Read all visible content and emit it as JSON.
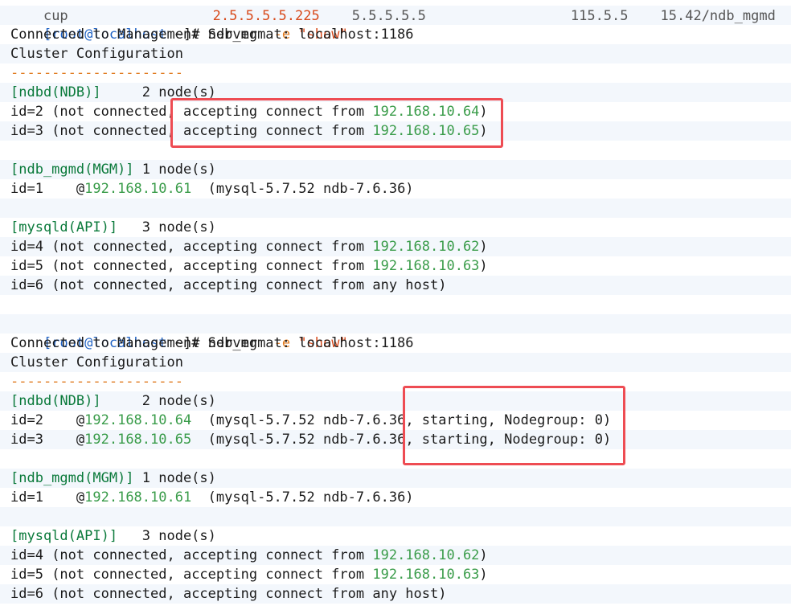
{
  "top_fragments": [
    {
      "text": "cup"
    },
    {
      "text": "2.5.5.5.5.225"
    },
    {
      "text": "5.5.5.5.5"
    },
    {
      "text": "115.5.5"
    },
    {
      "text": "15.42/ndb_mgmd"
    }
  ],
  "prompt": {
    "open": "[",
    "user_host": "root@localhost",
    "dir": " ~",
    "close": "]#",
    "cmd": " ndb_mgm ",
    "opt": "-e",
    "arg": "\"show\""
  },
  "texts": {
    "connected": "Connected to Management Server at: localhost:1186",
    "cluster_config": "Cluster Configuration",
    "separator": "---------------------",
    "ndbd_header_a": "[ndbd(NDB)]",
    "ndbd_header_b": "     2 node(s)",
    "mgmd_header_a": "[ndb_mgmd(MGM)]",
    "mgmd_header_b": " 1 node(s)",
    "mysqld_header_a": "[mysqld(API)]",
    "mysqld_header_b": "   3 node(s)",
    "not_connected": " (not connected, ",
    "accepting": "accepting connect from ",
    "any_host": "any host",
    "close_paren": ")",
    "mysql_ver": "  (mysql-5.7.52 ndb-7.6.36)",
    "mysql_ver_open": "  (mysql-5.7.52 ndb-7.6.36",
    "starting": ", starting, Nodegroup: 0)"
  },
  "block1": {
    "ndbd_nodes": [
      {
        "id": "id=2",
        "ip": "192.168.10.64"
      },
      {
        "id": "id=3",
        "ip": "192.168.10.65"
      }
    ],
    "mgmd_node": {
      "id": "id=1",
      "at": "    @",
      "ip": "192.168.10.61"
    },
    "mysqld_nodes": [
      {
        "id": "id=4",
        "ip": "192.168.10.62"
      },
      {
        "id": "id=5",
        "ip": "192.168.10.63"
      },
      {
        "id": "id=6",
        "ip": ""
      }
    ]
  },
  "block2": {
    "ndbd_nodes": [
      {
        "id": "id=2",
        "at": "    @",
        "ip": "192.168.10.64"
      },
      {
        "id": "id=3",
        "at": "    @",
        "ip": "192.168.10.65"
      }
    ],
    "mgmd_node": {
      "id": "id=1",
      "at": "    @",
      "ip": "192.168.10.61"
    },
    "mysqld_nodes": [
      {
        "id": "id=4",
        "ip": "192.168.10.62"
      },
      {
        "id": "id=5",
        "ip": "192.168.10.63"
      },
      {
        "id": "id=6",
        "ip": ""
      }
    ]
  },
  "colors": {
    "highlight": "#ee4c53",
    "ip": "#3a9c4a",
    "separator": "#e07a1e"
  }
}
